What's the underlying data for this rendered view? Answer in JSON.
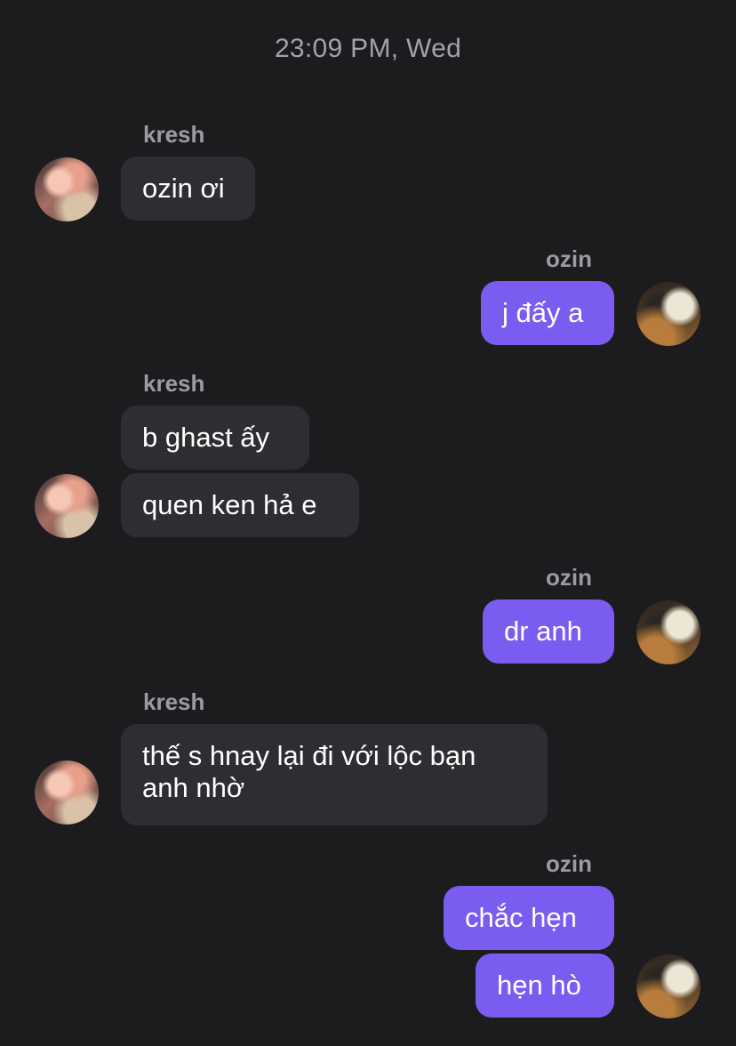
{
  "timestamp": "23:09 PM, Wed",
  "messages": [
    {
      "sender": "kresh",
      "direction": "incoming",
      "text": "ozin ơi"
    },
    {
      "sender": "ozin",
      "direction": "outgoing",
      "text": "j đấy a"
    },
    {
      "sender": "kresh",
      "direction": "incoming",
      "text": "b ghast ấy"
    },
    {
      "sender": "kresh",
      "direction": "incoming",
      "text": "quen ken hả e"
    },
    {
      "sender": "ozin",
      "direction": "outgoing",
      "text": "dr anh"
    },
    {
      "sender": "kresh",
      "direction": "incoming",
      "text": "thế s hnay lại đi với lộc bạn anh nhờ"
    },
    {
      "sender": "ozin",
      "direction": "outgoing",
      "text": "chắc hẹn"
    },
    {
      "sender": "ozin",
      "direction": "outgoing",
      "text": "hẹn hò"
    }
  ],
  "colors": {
    "background": "#1c1c1e",
    "incoming_bubble": "#2e2e32",
    "outgoing_bubble": "#7b5cf0",
    "meta_text": "#9b9ba1"
  },
  "icons": {
    "kresh_avatar": "avatar-kresh",
    "ozin_avatar": "avatar-ozin"
  }
}
